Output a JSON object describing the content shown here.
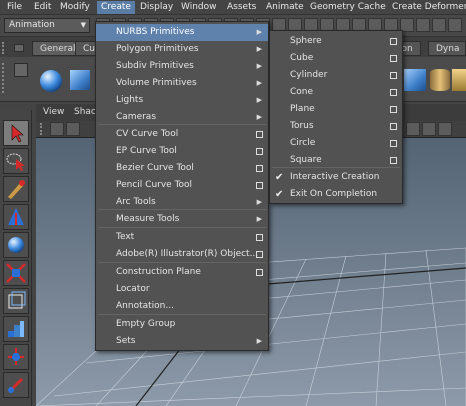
{
  "menubar": {
    "items": [
      "File",
      "Edit",
      "Modify",
      "Create",
      "Display",
      "Window",
      "Assets",
      "Animate",
      "Geometry Cache",
      "Create Deformers"
    ],
    "active_index": 3
  },
  "mode_selector": {
    "value": "Animation"
  },
  "shelf": {
    "tabs": [
      "General",
      "Curves"
    ],
    "right_tabs": [
      "ation",
      "Dyna"
    ]
  },
  "viewport": {
    "menu": [
      "View",
      "Shac"
    ]
  },
  "create_menu": {
    "items": [
      {
        "label": "NURBS Primitives",
        "type": "submenu",
        "highlighted": true
      },
      {
        "label": "Polygon Primitives",
        "type": "submenu"
      },
      {
        "label": "Subdiv Primitives",
        "type": "submenu"
      },
      {
        "label": "Volume Primitives",
        "type": "submenu"
      },
      {
        "label": "Lights",
        "type": "submenu"
      },
      {
        "label": "Cameras",
        "type": "submenu"
      },
      {
        "label": "CV Curve Tool",
        "type": "option"
      },
      {
        "label": "EP Curve Tool",
        "type": "option"
      },
      {
        "label": "Bezier Curve Tool",
        "type": "option"
      },
      {
        "label": "Pencil Curve Tool",
        "type": "option"
      },
      {
        "label": "Arc Tools",
        "type": "submenu"
      },
      {
        "label": "Measure Tools",
        "type": "submenu"
      },
      {
        "label": "Text",
        "type": "option"
      },
      {
        "label": "Adobe(R) Illustrator(R) Object...",
        "type": "option"
      },
      {
        "label": "Construction Plane",
        "type": "option"
      },
      {
        "label": "Locator",
        "type": "plain"
      },
      {
        "label": "Annotation...",
        "type": "plain"
      },
      {
        "label": "Empty Group",
        "type": "plain"
      },
      {
        "label": "Sets",
        "type": "submenu"
      }
    ]
  },
  "nurbs_submenu": {
    "items": [
      {
        "label": "Sphere",
        "type": "option"
      },
      {
        "label": "Cube",
        "type": "option"
      },
      {
        "label": "Cylinder",
        "type": "option"
      },
      {
        "label": "Cone",
        "type": "option"
      },
      {
        "label": "Plane",
        "type": "option"
      },
      {
        "label": "Torus",
        "type": "option"
      },
      {
        "label": "Circle",
        "type": "option"
      },
      {
        "label": "Square",
        "type": "option"
      },
      {
        "label": "Interactive Creation",
        "type": "check",
        "checked": true
      },
      {
        "label": "Exit On Completion",
        "type": "check",
        "checked": true
      }
    ]
  }
}
